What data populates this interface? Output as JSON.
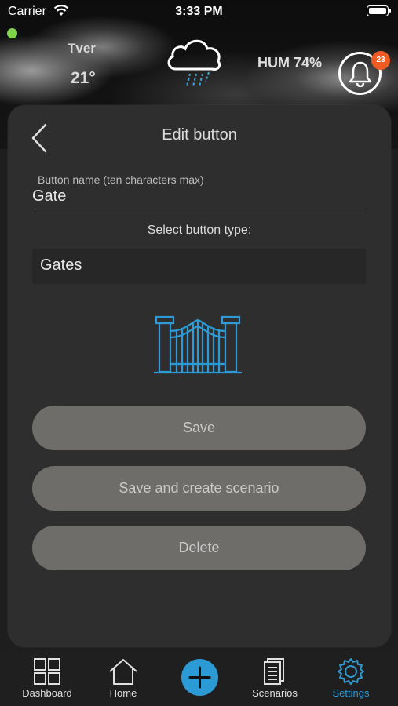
{
  "status_bar": {
    "carrier": "Carrier",
    "time": "3:33 PM"
  },
  "weather": {
    "city": "Tver",
    "temperature": "21°",
    "condition_icon": "rain-cloud-icon",
    "humidity": "HUM 74%"
  },
  "notifications": {
    "count": "23"
  },
  "edit": {
    "title": "Edit button",
    "name_label": "Button name (ten characters max)",
    "name_value": "Gate",
    "type_label": "Select button type:",
    "type_value": "Gates",
    "type_icon": "gate-icon"
  },
  "actions": {
    "save": "Save",
    "save_scenario": "Save and create scenario",
    "delete": "Delete"
  },
  "tabs": [
    {
      "label": "Dashboard",
      "icon": "grid-icon"
    },
    {
      "label": "Home",
      "icon": "house-icon"
    },
    {
      "label": "",
      "icon": "plus-icon"
    },
    {
      "label": "Scenarios",
      "icon": "document-icon"
    },
    {
      "label": "Settings",
      "icon": "gear-icon"
    }
  ],
  "colors": {
    "accent": "#2c9ad4",
    "badge": "#f05a23",
    "online": "#7fd34a",
    "card_bg": "#2e2e2e",
    "button_bg": "#6f6d69"
  }
}
